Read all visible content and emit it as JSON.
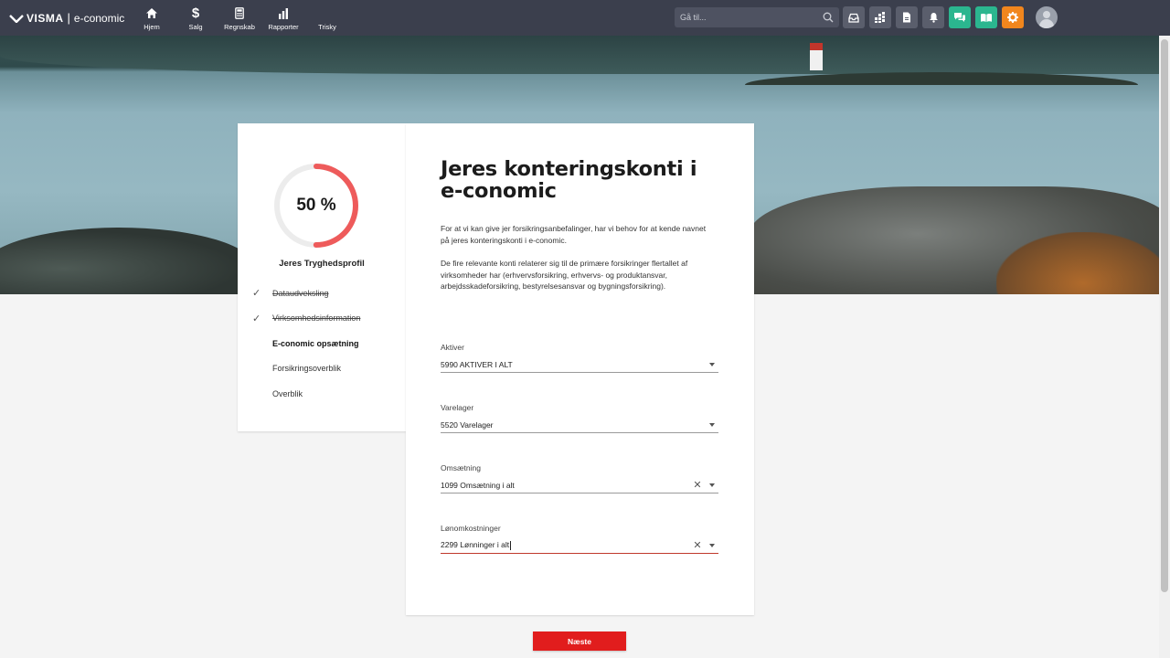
{
  "app": {
    "logo_mark": "VISMA",
    "logo_separator": "|",
    "logo_name": "e-conomic"
  },
  "nav": [
    {
      "label": "Hjem",
      "icon": "home-icon"
    },
    {
      "label": "Salg",
      "icon": "dollar-icon"
    },
    {
      "label": "Regnskab",
      "icon": "calculator-icon"
    },
    {
      "label": "Rapporter",
      "icon": "bar-chart-icon"
    },
    {
      "label": "Trisky",
      "icon": ""
    }
  ],
  "search": {
    "placeholder": "Gå til..."
  },
  "toolbar_icons": [
    "inbox-icon",
    "apps-icon",
    "document-icon",
    "bell-icon",
    "chat-icon",
    "book-icon",
    "gear-icon"
  ],
  "progress": {
    "percent": 50,
    "label": "50 %",
    "title": "Jeres Tryghedsprofil",
    "color": "#ee5b5b"
  },
  "steps": [
    {
      "label": "Dataudveksling",
      "state": "done"
    },
    {
      "label": "Virksomhedsinformation",
      "state": "done"
    },
    {
      "label": "E-conomic opsætning",
      "state": "active"
    },
    {
      "label": "Forsikringsoverblik",
      "state": "pending"
    },
    {
      "label": "Overblik",
      "state": "pending"
    }
  ],
  "main": {
    "title": "Jeres konteringskonti i e-conomic",
    "paragraph1": "For at vi kan give jer forsikringsanbefalinger, har vi behov for at kende navnet på jeres konteringskonti i e-conomic.",
    "paragraph2": "De fire relevante konti relaterer sig til de primære forsikringer flertallet af virksomheder har (erhvervsforsikring, erhvervs- og produktansvar, arbejdsskadeforsikring, bestyrelsesansvar og bygningsforsikring)."
  },
  "fields": [
    {
      "label": "Aktiver",
      "value": "5990 AKTIVER I ALT",
      "clearable": false
    },
    {
      "label": "Varelager",
      "value": "5520 Varelager",
      "clearable": false
    },
    {
      "label": "Omsætning",
      "value": "1099 Omsætning i alt",
      "clearable": true
    },
    {
      "label": "Lønomkostninger",
      "value": "2299 Lønninger i alt",
      "clearable": true
    }
  ],
  "next_button": {
    "label": "Næste",
    "color": "#e11d1d"
  }
}
